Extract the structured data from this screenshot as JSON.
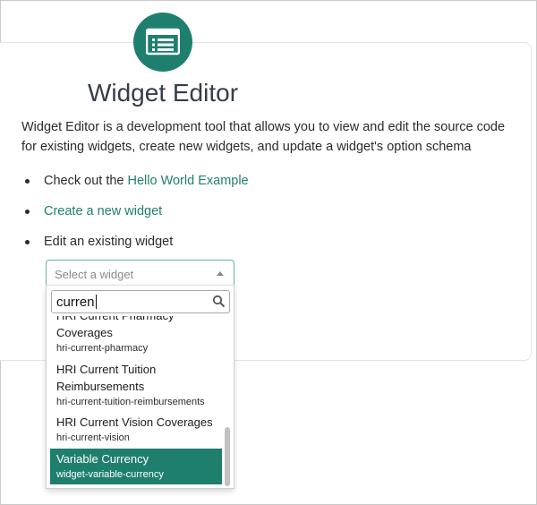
{
  "app": {
    "title": "Widget Editor",
    "accent_color": "#1f7f6e",
    "logo_icon": "list-icon"
  },
  "description": "Widget Editor is a development tool that allows you to view and edit the source code for existing widgets, create new widgets, and update a widget's option schema",
  "bullets": {
    "item1_prefix": "Check out the ",
    "item1_link": "Hello World Example",
    "item2_link": "Create a new widget",
    "item3_text": "Edit an existing widget"
  },
  "select": {
    "placeholder": "Select a widget",
    "search_value": "curren",
    "options": [
      {
        "name_line1": "HRI Current Pharmacy",
        "name_line2": "Coverages",
        "slug": "hri-current-pharmacy"
      },
      {
        "name_line1": "HRI Current Tuition",
        "name_line2": "Reimbursements",
        "slug": "hri-current-tuition-reimbursements"
      },
      {
        "name_line1": "HRI Current Vision Coverages",
        "slug": "hri-current-vision"
      },
      {
        "name_line1": "Variable Currency",
        "slug": "widget-variable-currency",
        "selected": true
      }
    ]
  }
}
